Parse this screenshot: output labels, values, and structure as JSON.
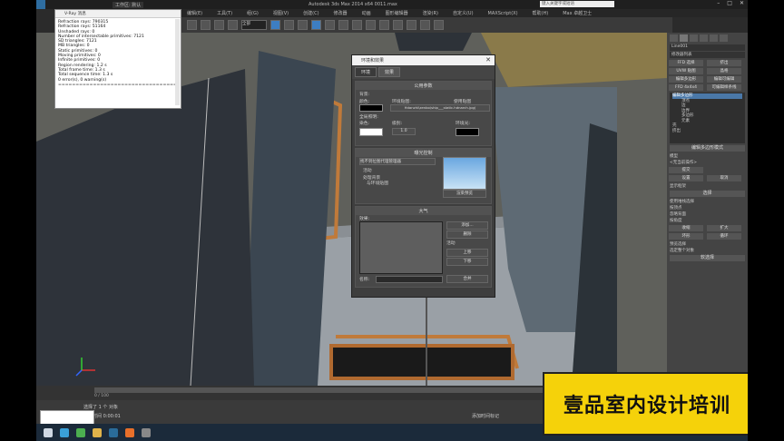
{
  "app": {
    "title": "Autodesk 3ds Max  2014 x64      0011.max",
    "workspace": "工作区: 默认",
    "search_placeholder": "键入关键字或短语"
  },
  "menu": [
    "编辑(E)",
    "工具(T)",
    "组(G)",
    "视图(V)",
    "创建(C)",
    "修改器",
    "动画",
    "图形编辑器",
    "渲染(R)",
    "自定义(U)",
    "MAXScript(X)",
    "帮助(H)",
    "Max 卓越卫士"
  ],
  "toolbar": {
    "selection_filter": "全部"
  },
  "vray_window": {
    "title": "V-Ray 消息",
    "lines": [
      "Refraction rays: 790315",
      "Refraction rays: 51164",
      "Unshaded rays: 0",
      "Number of intersectable primitives: 7121",
      "SD triangles: 7121",
      "MB triangles: 0",
      "Static primitives: 0",
      "Moving primitives: 0",
      "Infinite primitives: 0",
      "Region rendering: 1.2 s",
      "Total frame time: 1.3 s",
      "Total sequence time: 1.3 s",
      "0 error(s), 0 warning(s)",
      "=================================="
    ]
  },
  "env_dialog": {
    "title": "环境和效果",
    "tabs": [
      "环境",
      "效果"
    ],
    "common_params_header": "公用参数",
    "background_label": "背景:",
    "color_label": "颜色:",
    "env_map_label": "环境贴图:",
    "use_map_label": "使用贴图",
    "map_path": "Hdanzhi\\zenbo\\ship___static.hdnarch.jpg)",
    "global_lighting_label": "全局照明:",
    "tint_label": "染色:",
    "level_label": "级别:",
    "level_value": "1.0",
    "ambient_label": "环境光:",
    "exposure_header": "曝光控制",
    "exposure_value": "找不到位图代理管理器",
    "active_label": "活动",
    "process_bg_label": "处理背景",
    "and_env_label": "与环境贴图",
    "render_preview_label": "渲染预览",
    "atmosphere_header": "大气",
    "effects_label": "效果:",
    "add_label": "添加...",
    "delete_label": "删除",
    "active2_label": "活动",
    "move_up_label": "上移",
    "move_down_label": "下移",
    "merge_label": "合并",
    "name_label": "名称:"
  },
  "cmd_panel": {
    "object_name": "Line001",
    "modifier_list": "修改器列表",
    "buttons": [
      "FFD 选择",
      "挤出",
      "UVW 贴图",
      "晶格",
      "编辑多边形",
      "编辑可编辑",
      "FFD 4x4x4",
      "可编辑样条线"
    ],
    "stack_items": [
      "编辑多边形",
      "顶点",
      "边",
      "边界",
      "多边形",
      "元素",
      "壳",
      "挤出"
    ],
    "rollout_poly_mode": "编辑多边形模式",
    "model_label": "模型",
    "animate_label": "动画",
    "no_op_label": "<无当前操作>",
    "commit_label": "提交",
    "settings_label": "设置",
    "cancel_label": "取消",
    "show_cage_label": "显示框架",
    "selection_header": "选择",
    "by_vertex_label": "使用堆栈选择",
    "by_angle_label": "按顶点",
    "ignore_back_label": "忽略背面",
    "by_angle2_label": "按角度",
    "angle_value": "45.0",
    "shrink_label": "收缩",
    "grow_label": "扩大",
    "ring_label": "环形",
    "loop_label": "循环",
    "preview_sel_label": "预览选择",
    "off_label": "关闭",
    "subobj_label": "子对象",
    "multi_label": "多个",
    "select_all_label": "选定整个对象",
    "soft_sel_header": "软选择"
  },
  "timeline": {
    "frame": "0 / 100"
  },
  "status": {
    "selected": "选择了 1 个 对象",
    "hint": "渲染时间  0:00:01",
    "add_time_tag": "添加时间标记"
  },
  "banner": {
    "text": "壹品室内设计培训"
  }
}
